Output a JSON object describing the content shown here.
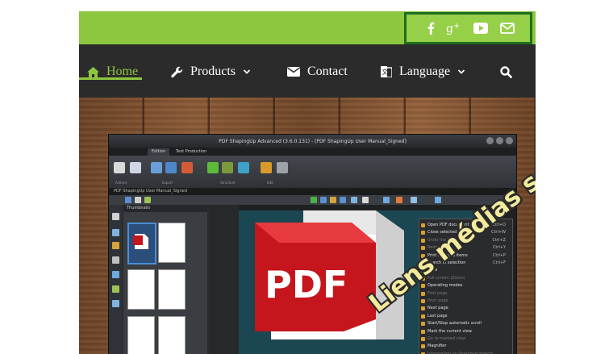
{
  "colors": {
    "accent_green": "#8dc63f",
    "nav_bg": "#2b2b2b",
    "highlight_border": "#1f6d1f",
    "overlay_text": "#f3ea9c"
  },
  "social": {
    "items": [
      {
        "name": "facebook",
        "icon": "facebook-icon",
        "label": "f"
      },
      {
        "name": "google-plus",
        "icon": "google-plus-icon",
        "label": "g+"
      },
      {
        "name": "youtube",
        "icon": "youtube-icon"
      },
      {
        "name": "email",
        "icon": "envelope-icon"
      }
    ]
  },
  "nav": {
    "home": "Home",
    "products": "Products",
    "contact": "Contact",
    "language": "Language",
    "search_icon": "search-icon"
  },
  "overlay": {
    "text": "Liens médias sociaux >"
  },
  "app": {
    "title": "PDF ShapingUp Advanced (3.6.0.131) - [PDF ShapingUp User Manual_Signed]",
    "tabs": [
      "Edition",
      "Text Production"
    ],
    "open_file": "PDF ShapingUp User Manual_Signed",
    "ribbon_groups": [
      "Actions",
      "Export",
      "Structure",
      "Edit"
    ],
    "thumbnails_label": "Thumbnails",
    "pdf_logo": "PDF",
    "context_menu": [
      {
        "label": "Open PDF documents",
        "key": "Ctrl+O",
        "dim": false
      },
      {
        "label": "Close selected items",
        "key": "Ctrl+W",
        "dim": false
      },
      {
        "label": "Undo the last change",
        "key": "Ctrl+Z",
        "dim": true
      },
      {
        "label": "Redo",
        "key": "Ctrl+Y",
        "dim": true
      },
      {
        "label": "Print selected items",
        "key": "Ctrl+P",
        "dim": false
      },
      {
        "label": "Search in selection",
        "key": "Ctrl+F",
        "dim": false
      },
      {
        "label": "Save",
        "key": "",
        "dim": false
      },
      {
        "label": "Full screen (Zoom)",
        "key": "",
        "dim": true
      },
      {
        "label": "Operating modes",
        "key": "",
        "dim": false
      },
      {
        "label": "First page",
        "key": "",
        "dim": true
      },
      {
        "label": "Prior page",
        "key": "",
        "dim": true
      },
      {
        "label": "Next page",
        "key": "",
        "dim": false
      },
      {
        "label": "Last page",
        "key": "",
        "dim": false
      },
      {
        "label": "Start/Stop automatic scroll",
        "key": "",
        "dim": false
      },
      {
        "label": "Mark the current view",
        "key": "",
        "dim": false
      },
      {
        "label": "Go to marked view",
        "key": "",
        "dim": true
      },
      {
        "label": "Magnifier",
        "key": "",
        "dim": false
      },
      {
        "label": "Information on Searched objects",
        "key": "",
        "dim": true
      }
    ]
  }
}
